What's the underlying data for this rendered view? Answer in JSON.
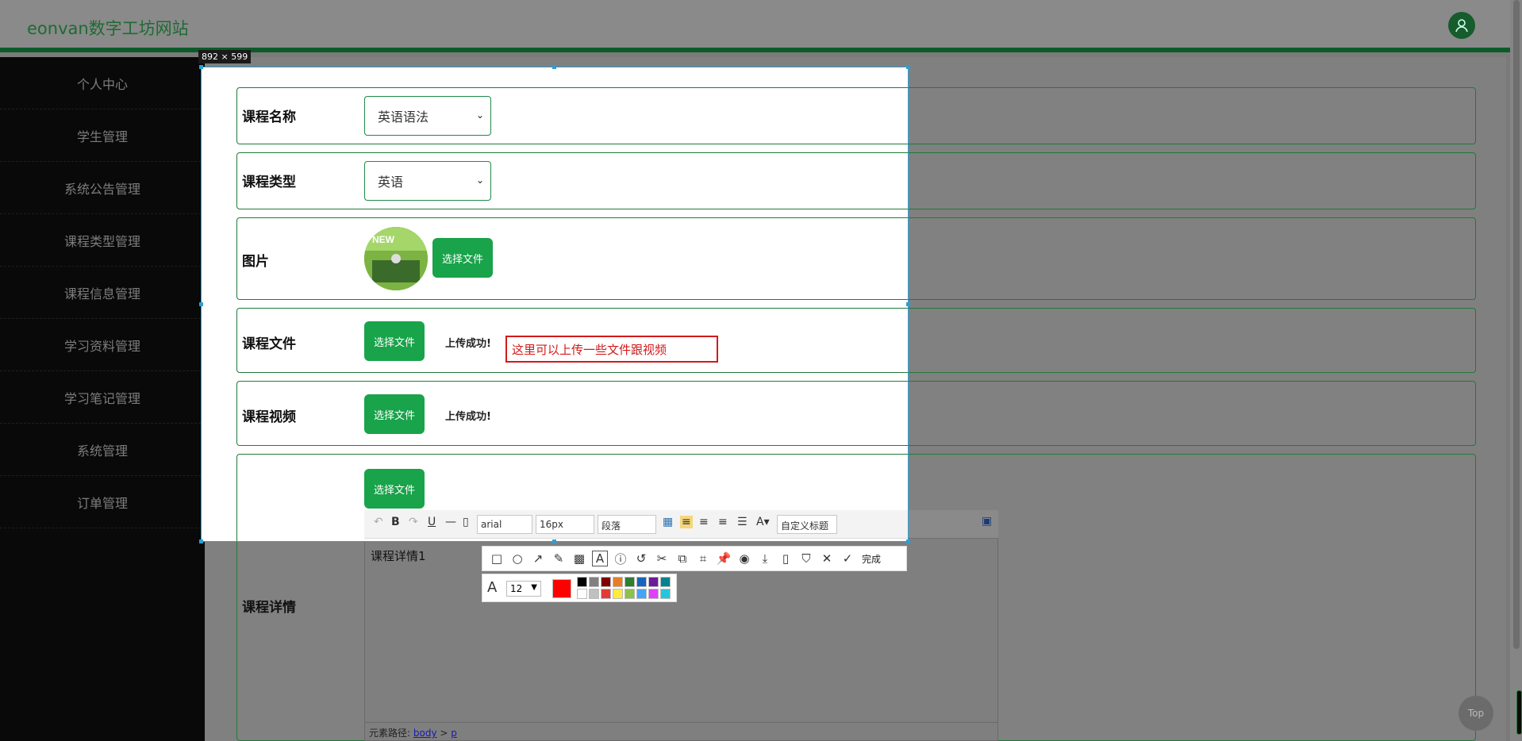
{
  "app": {
    "title": "eonvan数字工坊网站"
  },
  "sidebar": {
    "items": [
      {
        "label": "个人中心"
      },
      {
        "label": "学生管理"
      },
      {
        "label": "系统公告管理"
      },
      {
        "label": "课程类型管理"
      },
      {
        "label": "课程信息管理"
      },
      {
        "label": "学习资料管理"
      },
      {
        "label": "学习笔记管理"
      },
      {
        "label": "系统管理"
      },
      {
        "label": "订单管理"
      }
    ]
  },
  "form": {
    "course_name": {
      "label": "课程名称",
      "value": "英语语法"
    },
    "course_type": {
      "label": "课程类型",
      "value": "英语"
    },
    "image": {
      "label": "图片",
      "button": "选择文件"
    },
    "course_file": {
      "label": "课程文件",
      "button": "选择文件",
      "status": "上传成功!"
    },
    "course_video": {
      "label": "课程视频",
      "button": "选择文件",
      "status": "上传成功!"
    },
    "extra": {
      "button": "选择文件"
    },
    "details": {
      "label": "课程详情",
      "content": "课程详情1"
    }
  },
  "editor": {
    "font_family": "arial",
    "font_size": "16px",
    "paragraph": "段落",
    "custom_title": "自定义标题",
    "path_label": "元素路径:",
    "path": [
      "body",
      "p"
    ]
  },
  "snip": {
    "size": "892 × 599",
    "annotation": "这里可以上传一些文件跟视频",
    "done": "完成",
    "font_size": "12",
    "selected_color": "#ff0000",
    "palette": [
      "#000000",
      "#808080",
      "#800000",
      "#e67e22",
      "#2e7d32",
      "#1565c0",
      "#6a1b9a",
      "#00838f",
      "#ffffff",
      "#c0c0c0",
      "#e53935",
      "#ffeb3b",
      "#8bc34a",
      "#42a5f5",
      "#e040fb",
      "#26c6da"
    ]
  },
  "back_to_top": "Top"
}
